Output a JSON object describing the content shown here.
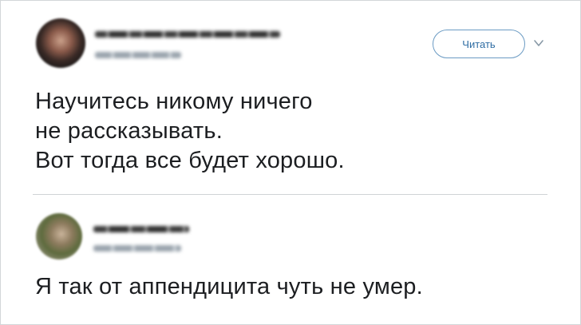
{
  "tweet1": {
    "follow_label": "Читать",
    "lines": [
      "Научитесь никому ничего",
      "не рассказывать.",
      "Вот тогда все будет хорошо."
    ],
    "menu_icon": "chevron-down-icon"
  },
  "tweet2": {
    "lines": [
      "Я так от аппендицита чуть не умер."
    ]
  },
  "colors": {
    "follow_border": "#6b9bc3",
    "follow_text": "#2f6da3",
    "text": "#1c1e21",
    "divider": "#cfd3d6"
  }
}
